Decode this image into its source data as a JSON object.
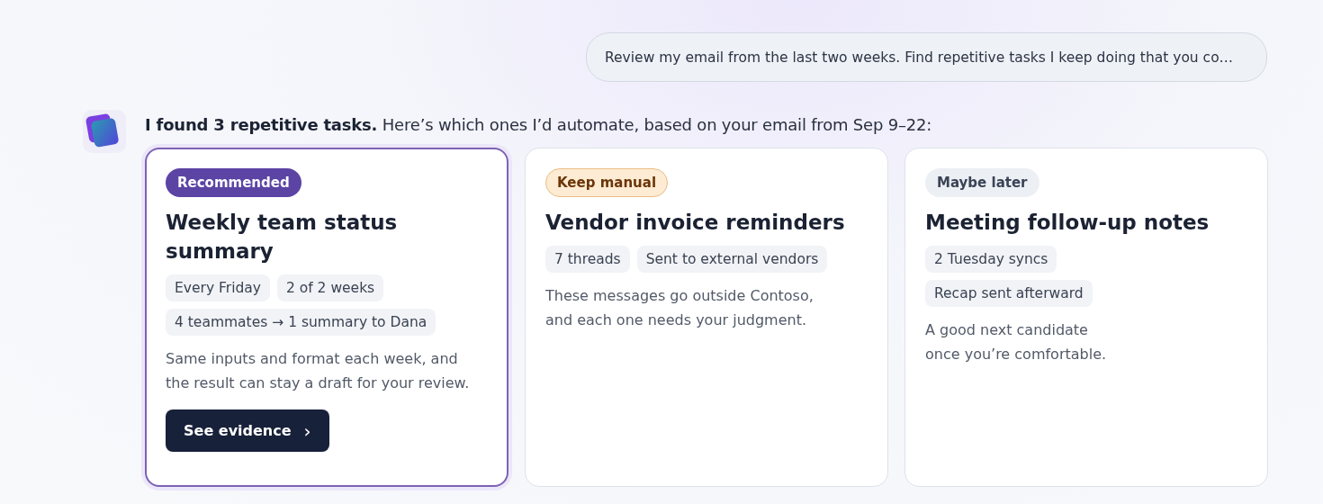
{
  "user_message": "Review my email from the last two weeks. Find repetitive tasks I keep doing that you co…",
  "reply": {
    "text": "**I found 3 repetitive tasks.** Here’s which ones I’d automate, based on your email from Sep 9–22:"
  },
  "cards": [
    {
      "badge": {
        "label": "Recommended",
        "kind": "recommended"
      },
      "title": "Weekly team status summary",
      "tags": [
        "Every Friday",
        "2 of 2 weeks",
        "4 teammates → 1 summary to Dana"
      ],
      "description": "Same inputs and format each week, and\nthe result can stay a draft for your review.",
      "button": {
        "label": "See evidence",
        "icon": "›"
      }
    },
    {
      "badge": {
        "label": "Keep manual",
        "kind": "manual"
      },
      "title": "Vendor invoice reminders",
      "tags": [
        "7 threads",
        "Sent to external vendors"
      ],
      "description": "These messages go outside Contoso,\nand each one needs your judgment."
    },
    {
      "badge": {
        "label": "Maybe later",
        "kind": "later"
      },
      "title": "Meeting follow-up notes",
      "tags": [
        "2 Tuesday syncs",
        "Recap sent afterward"
      ],
      "description": "A good next candidate\nonce you’re comfortable."
    }
  ]
}
